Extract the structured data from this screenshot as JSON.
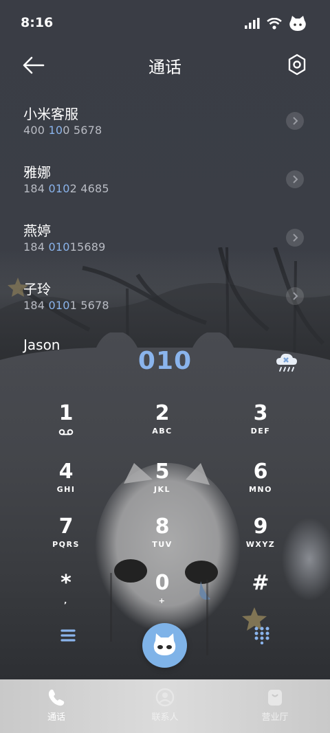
{
  "status_bar": {
    "time": "8:16"
  },
  "header": {
    "title": "通话"
  },
  "contacts": [
    {
      "name": "小米客服",
      "num_a": "400 ",
      "num_hl": "10",
      "num_b": "0 5678"
    },
    {
      "name": "雅娜",
      "num_a": "184 ",
      "num_hl": "010",
      "num_b": "2 4685"
    },
    {
      "name": "燕婷",
      "num_a": "184 ",
      "num_hl": "010",
      "num_b": "15689"
    },
    {
      "name": "子玲",
      "num_a": "184 ",
      "num_hl": "010",
      "num_b": "1 5678"
    },
    {
      "name": "Jason",
      "num_a": "",
      "num_hl": "",
      "num_b": ""
    }
  ],
  "dialpad": {
    "input": "010",
    "keys": [
      {
        "digit": "1",
        "letters": ""
      },
      {
        "digit": "2",
        "letters": "ABC"
      },
      {
        "digit": "3",
        "letters": "DEF"
      },
      {
        "digit": "4",
        "letters": "GHI"
      },
      {
        "digit": "5",
        "letters": "JKL"
      },
      {
        "digit": "6",
        "letters": "MNO"
      },
      {
        "digit": "7",
        "letters": "PQRS"
      },
      {
        "digit": "8",
        "letters": "TUV"
      },
      {
        "digit": "9",
        "letters": "WXYZ"
      },
      {
        "digit": "*",
        "letters": ","
      },
      {
        "digit": "0",
        "letters": "+"
      },
      {
        "digit": "#",
        "letters": ""
      }
    ]
  },
  "bottom_nav": {
    "tabs": [
      {
        "label": "通话",
        "active": true
      },
      {
        "label": "联系人",
        "active": false
      },
      {
        "label": "营业厅",
        "active": false
      }
    ]
  },
  "colors": {
    "accent": "#8ab4ec",
    "call_button": "#7fb3e8"
  }
}
